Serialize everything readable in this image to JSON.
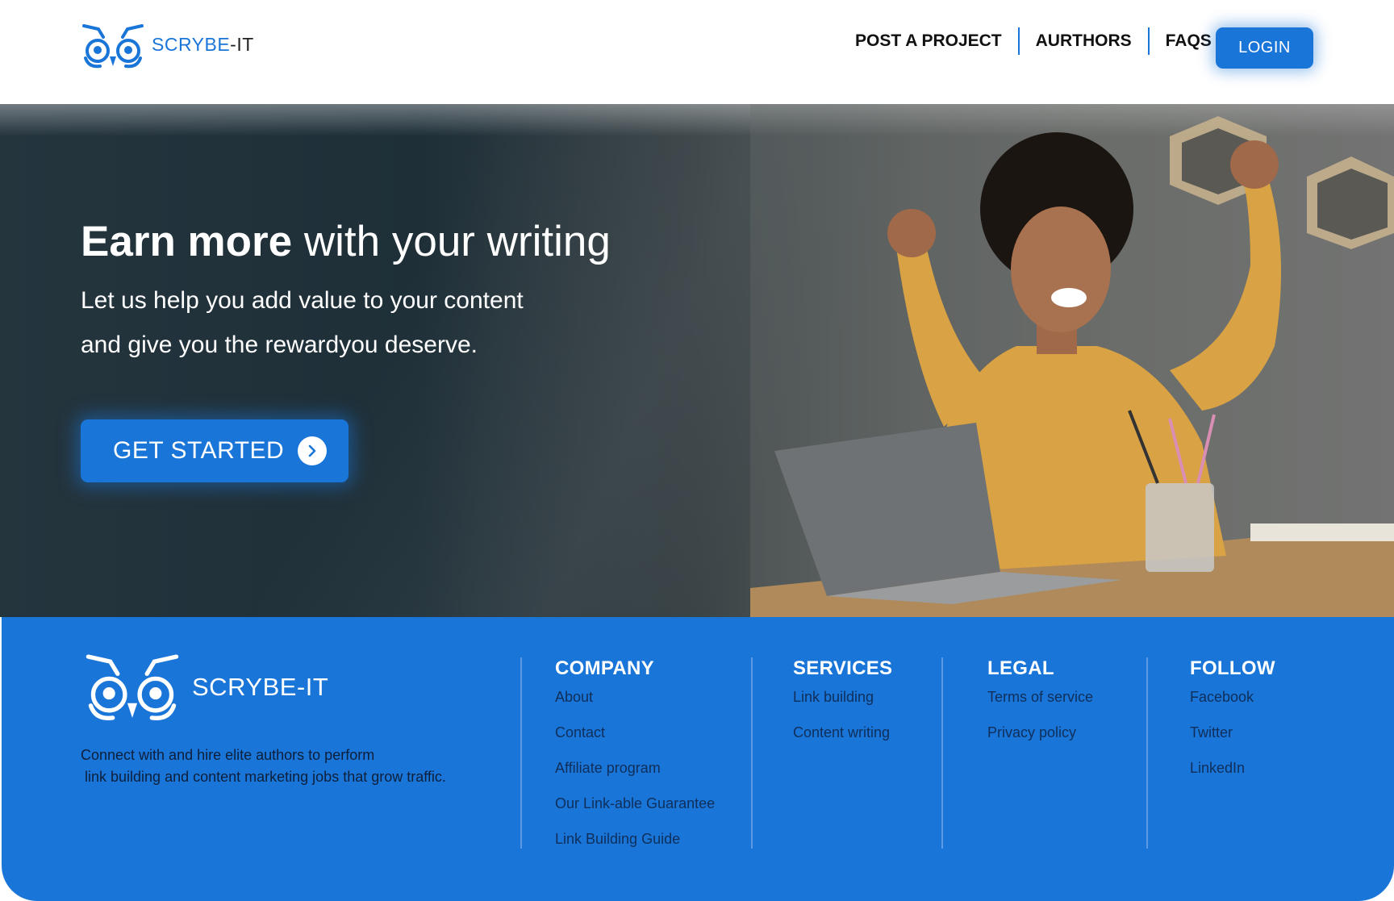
{
  "brand": {
    "name_prefix": "SCRYBE",
    "name_suffix": "-IT",
    "accent": "#1a75d8"
  },
  "nav": {
    "items": [
      "POST A PROJECT",
      "AURTHORS",
      "FAQS"
    ],
    "login_label": "LOGIN"
  },
  "hero": {
    "title_bold": "Earn more",
    "title_rest": " with your writing",
    "subtitle_line1": "Let us help you add value to your content",
    "subtitle_line2": "and give you the rewardyou deserve.",
    "cta_label": "GET STARTED",
    "cta_icon": "chevron-right-icon"
  },
  "footer": {
    "brand_name": "SCRYBE-IT",
    "description_line1": "Connect with and hire elite authors to perform",
    "description_line2": " link building and content marketing jobs that grow traffic.",
    "columns": [
      {
        "title": "COMPANY",
        "links": [
          "About",
          "Contact",
          "Affiliate program",
          "Our Link-able Guarantee",
          "Link Building Guide"
        ]
      },
      {
        "title": "SERVICES",
        "links": [
          "Link building",
          "Content writing"
        ]
      },
      {
        "title": "LEGAL",
        "links": [
          "Terms of service",
          "Privacy policy"
        ]
      },
      {
        "title": "FOLLOW",
        "links": [
          "Facebook",
          "Twitter",
          "LinkedIn"
        ]
      }
    ]
  }
}
